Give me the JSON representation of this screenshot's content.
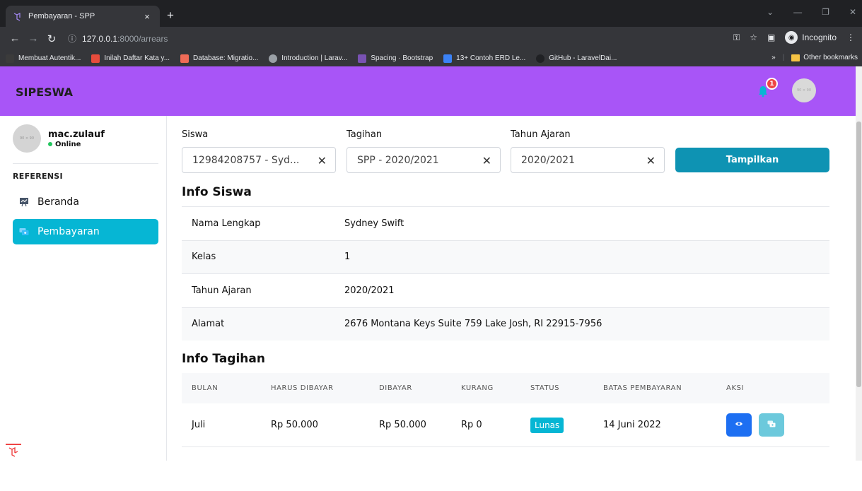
{
  "browser": {
    "tab_title": "Pembayaran - SPP",
    "tab_close": "×",
    "new_tab": "+",
    "url_host": "127.0.0.1",
    "url_path": ":8000/arrears",
    "incognito_label": "Incognito",
    "bookmarks": [
      {
        "label": "Membuat Autentik...",
        "color": "#3b3b3b"
      },
      {
        "label": "Inilah Daftar Kata y...",
        "color": "#e74c3c"
      },
      {
        "label": "Database: Migratio...",
        "color": "#ef6b57"
      },
      {
        "label": "Introduction | Larav...",
        "color": "#9aa0a6"
      },
      {
        "label": "Spacing · Bootstrap",
        "color": "#7952b3"
      },
      {
        "label": "13+ Contoh ERD Le...",
        "color": "#3b82f6"
      },
      {
        "label": "GitHub - LaravelDai...",
        "color": "#202124"
      }
    ],
    "bookmarks_more": "»",
    "other_bookmarks": "Other bookmarks"
  },
  "header": {
    "brand": "SIPESWA",
    "notif_count": "1",
    "avatar_text": "90 × 90"
  },
  "sidebar": {
    "avatar_text": "90 × 90",
    "username": "mac.zulauf",
    "status": "Online",
    "section": "REFERENSI",
    "items": [
      {
        "label": "Beranda",
        "active": false
      },
      {
        "label": "Pembayaran",
        "active": true
      }
    ]
  },
  "filters": {
    "siswa_label": "Siswa",
    "siswa_value": "12984208757 - Syd...",
    "tagihan_label": "Tagihan",
    "tagihan_value": "SPP - 2020/2021",
    "tahun_label": "Tahun Ajaran",
    "tahun_value": "2020/2021",
    "clear": "✕",
    "submit": "Tampilkan"
  },
  "info_siswa": {
    "title": "Info Siswa",
    "rows": [
      {
        "key": "Nama Lengkap",
        "value": "Sydney Swift"
      },
      {
        "key": "Kelas",
        "value": "1"
      },
      {
        "key": "Tahun Ajaran",
        "value": "2020/2021"
      },
      {
        "key": "Alamat",
        "value": "2676 Montana Keys Suite 759 Lake Josh, RI 22915-7956"
      }
    ]
  },
  "info_tagihan": {
    "title": "Info Tagihan",
    "columns": [
      "BULAN",
      "HARUS DIBAYAR",
      "DIBAYAR",
      "KURANG",
      "STATUS",
      "BATAS PEMBAYARAN",
      "AKSI"
    ],
    "rows": [
      {
        "bulan": "Juli",
        "harus": "Rp 50.000",
        "dibayar": "Rp 50.000",
        "kurang": "Rp 0",
        "status": "Lunas",
        "batas": "14 Juni 2022"
      }
    ]
  },
  "colors": {
    "header_bg": "#a855f7",
    "active_nav": "#06b6d4",
    "submit_btn": "#0e93b3",
    "view_btn": "#1d6ff2",
    "pay_btn": "#6cc9dc"
  }
}
